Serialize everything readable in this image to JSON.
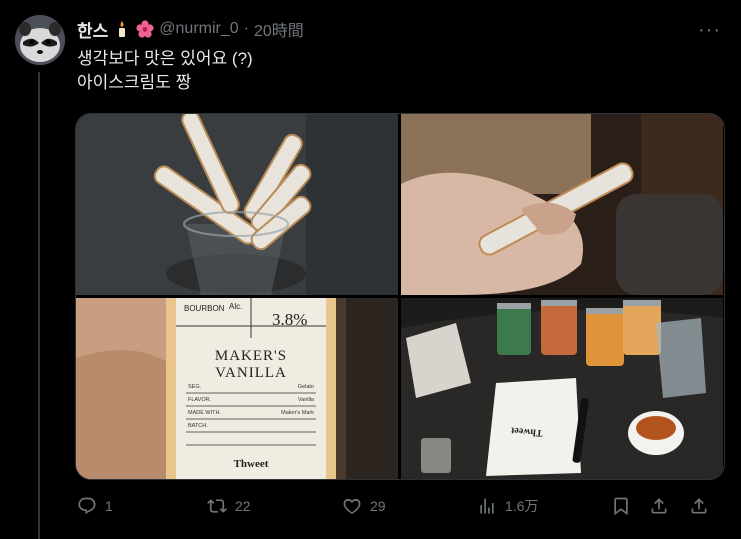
{
  "tweet": {
    "display_name": "한스",
    "handle": "@nurmir_0",
    "separator": "·",
    "time": "20時間",
    "lines": [
      "생각보다 맛은 있어요 (?)",
      "아이스크림도 짱"
    ],
    "more_label": "···"
  },
  "bottle_label": {
    "type": "BOURBON",
    "alc_label": "Alc.",
    "abv": "3.8%",
    "name_line1": "MAKER'S",
    "name_line2": "VANILLA",
    "rows": [
      {
        "k": "SEG.",
        "v": "Gelato"
      },
      {
        "k": "FLAVOR.",
        "v": "Vanilla"
      },
      {
        "k": "MADE WITH.",
        "v": "Maker's Mark"
      },
      {
        "k": "BATCH.",
        "v": ""
      }
    ],
    "brand": "Thweet"
  },
  "napkin_brand": "Thweet",
  "actions": {
    "replies": "1",
    "retweets": "22",
    "likes": "29",
    "views": "1.6万"
  }
}
